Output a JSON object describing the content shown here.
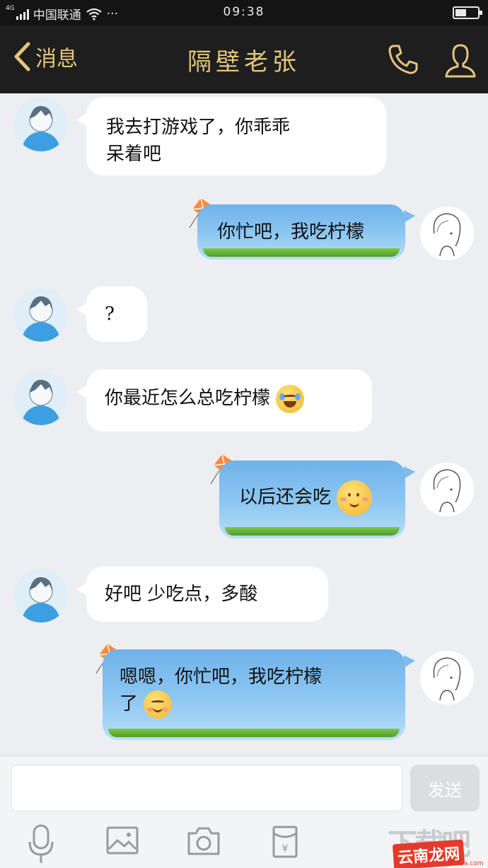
{
  "status": {
    "network": "4G",
    "carrier": "中国联通",
    "dots": "···",
    "time": "09:38"
  },
  "header": {
    "back_label": "消息",
    "title": "隔壁老张",
    "accent": "#e3c57c"
  },
  "messages": [
    {
      "side": "in",
      "text_lines": [
        "我去打游戏了，你乖乖",
        "呆着吧"
      ],
      "emoji": ""
    },
    {
      "side": "out",
      "text_lines": [
        "你忙吧，我吃柠檬"
      ],
      "emoji": ""
    },
    {
      "side": "in",
      "text_lines": [
        "?"
      ],
      "emoji": ""
    },
    {
      "side": "in",
      "text_lines": [
        "你最近怎么总吃柠檬"
      ],
      "emoji": "tears-of-joy"
    },
    {
      "side": "out",
      "text_lines": [
        "以后还会吃"
      ],
      "emoji": "blush"
    },
    {
      "side": "in",
      "text_lines": [
        "好吧 少吃点，多酸"
      ],
      "emoji": ""
    },
    {
      "side": "out",
      "text_lines": [
        "嗯嗯，你忙吧，我吃柠檬",
        "了"
      ],
      "emoji": "smile"
    }
  ],
  "composer": {
    "placeholder": "",
    "send_label": "发送"
  },
  "toolbar_icons": [
    "microphone-icon",
    "image-icon",
    "camera-icon",
    "red-packet-icon"
  ],
  "watermark": {
    "text": "下载吧",
    "badge": "云南龙网",
    "url": "www.xiazaiba.com"
  }
}
